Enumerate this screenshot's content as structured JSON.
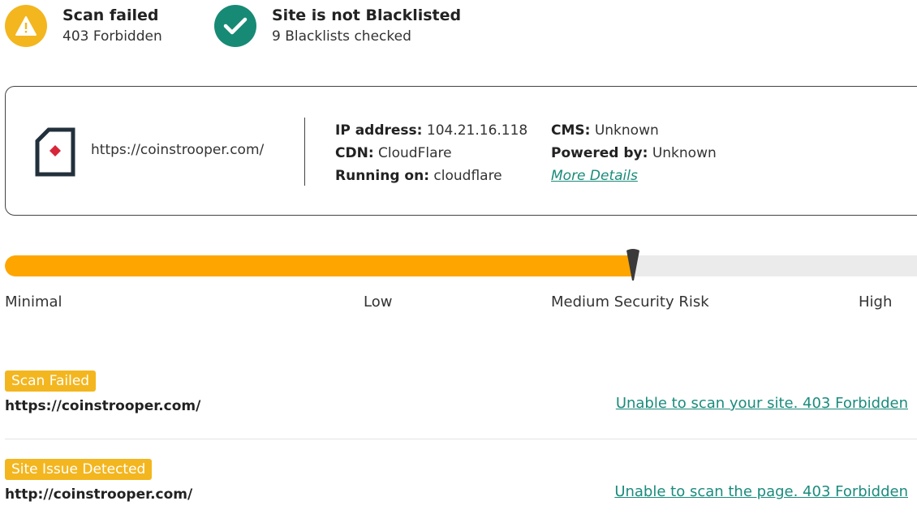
{
  "status": {
    "scan": {
      "title": "Scan failed",
      "subtitle": "403 Forbidden",
      "icon": "warning-icon",
      "color": "#f3b61f"
    },
    "blacklist": {
      "title": "Site is not Blacklisted",
      "subtitle": "9 Blacklists checked",
      "icon": "check-icon",
      "color": "#178a75"
    }
  },
  "site": {
    "url": "https://coinstrooper.com/",
    "icon": "site-diamond-icon",
    "ip_label": "IP address:",
    "ip_value": "104.21.16.118",
    "cdn_label": "CDN:",
    "cdn_value": "CloudFlare",
    "running_label": "Running on:",
    "running_value": "cloudflare",
    "cms_label": "CMS:",
    "cms_value": "Unknown",
    "powered_label": "Powered by:",
    "powered_value": "Unknown",
    "more_details": "More Details"
  },
  "risk": {
    "level_fraction": 0.683,
    "fill_color": "#ffa500",
    "labels": {
      "minimal": "Minimal",
      "low": "Low",
      "medium": "Medium Security Risk",
      "high": "High"
    }
  },
  "issues": [
    {
      "badge": "Scan Failed",
      "url": "https://coinstrooper.com/",
      "message": "Unable to scan your site. 403 Forbidden"
    },
    {
      "badge": "Site Issue Detected",
      "url": "http://coinstrooper.com/",
      "message": "Unable to scan the page. 403 Forbidden"
    }
  ],
  "colors": {
    "accent_link": "#1a8b7c",
    "badge": "#f3b61f"
  }
}
